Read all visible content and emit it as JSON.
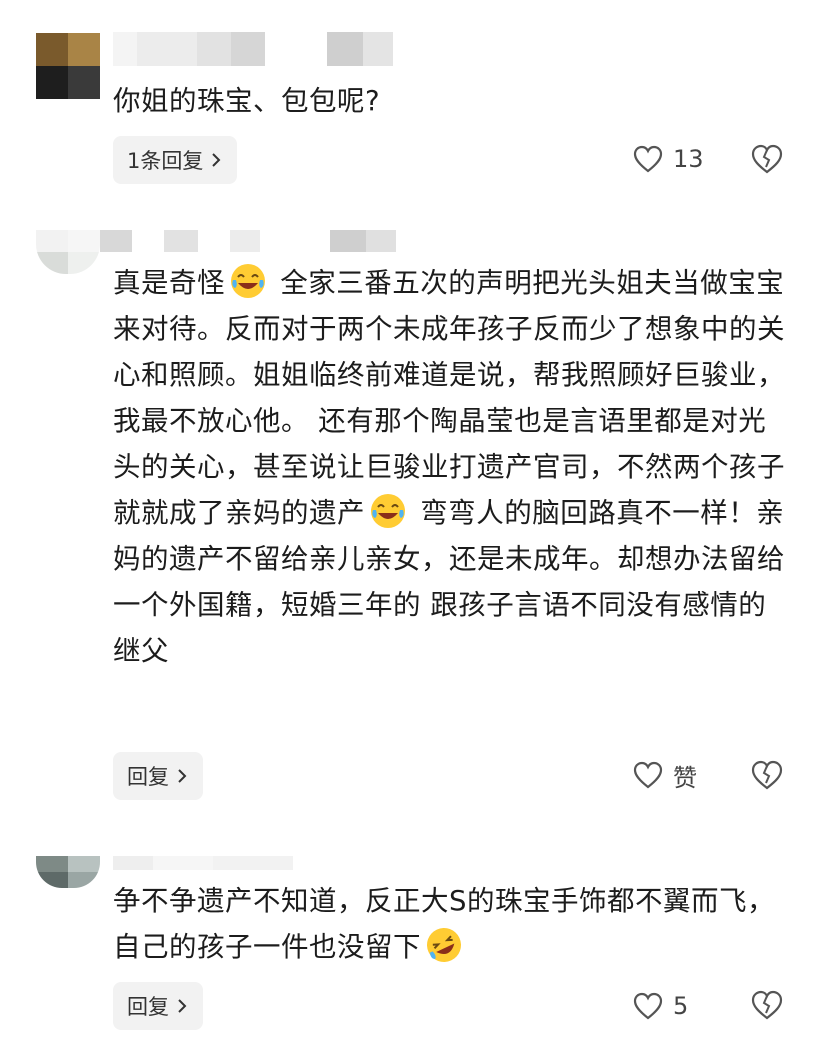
{
  "comments": [
    {
      "text": "你姐的珠宝、包包呢?",
      "reply_label": "1条回复",
      "like_label": "13"
    },
    {
      "text_parts": [
        "真是奇怪",
        " 全家三番五次的声明把光头姐夫当做宝宝来对待。反而对于两个未成年孩子反而少了想象中的关心和照顾。姐姐临终前难道是说，帮我照顾好巨骏业，我最不放心他。 还有那个陶晶莹也是言语里都是对光头的关心，甚至说让巨骏业打遗产官司，不然两个孩子就就成了亲妈的遗产",
        " 弯弯人的脑回路真不一样！亲妈的遗产不留给亲儿亲女，还是未成年。却想办法留给一个外国籍，短婚三年的 跟孩子言语不同没有感情的继父"
      ],
      "reply_label": "回复",
      "like_label": "赞"
    },
    {
      "text_parts": [
        "争不争遗产不知道，反正大S的珠宝手饰都不翼而飞，自己的孩子一件也没留下"
      ],
      "reply_label": "回复",
      "like_label": "5"
    }
  ],
  "icons": {
    "like": "heart-outline-icon",
    "dislike": "broken-heart-icon",
    "reply_chevron": "chevron-right-icon",
    "emoji_laugh": "tears-of-joy-emoji",
    "emoji_rofl": "rolling-laughing-emoji"
  },
  "colors": {
    "text": "#1c1c1c",
    "pill_bg": "#f2f2f2",
    "meta": "#444444",
    "emoji_face": "#ffcc33"
  }
}
